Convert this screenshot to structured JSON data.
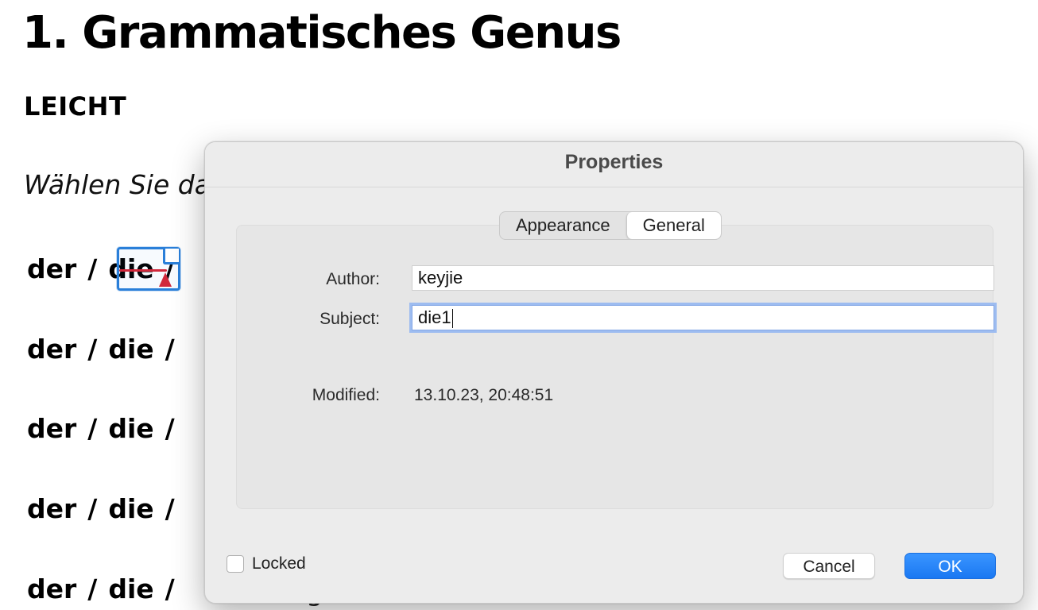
{
  "document": {
    "title": "1. Grammatisches Genus",
    "level": "LEICHT",
    "instruction": "Wählen Sie da",
    "rows": [
      {
        "a": "der",
        "sep1": "/",
        "b": "die",
        "sep2": "/"
      },
      {
        "a": "der",
        "sep1": "/",
        "b": "die",
        "sep2": "/"
      },
      {
        "a": "der",
        "sep1": "/",
        "b": "die",
        "sep2": "/"
      },
      {
        "a": "der",
        "sep1": "/",
        "b": "die",
        "sep2": "/"
      },
      {
        "a": "der",
        "sep1": "/",
        "b": "die",
        "sep2": "/"
      }
    ],
    "trailing_glyph": "g",
    "annotation_color": "#2a7fd9",
    "strike_color": "#d1283b"
  },
  "dialog": {
    "title": "Properties",
    "tabs": [
      {
        "label": "Appearance",
        "selected": false
      },
      {
        "label": "General",
        "selected": true
      }
    ],
    "fields": {
      "author_label": "Author:",
      "author_value": "keyjie",
      "subject_label": "Subject:",
      "subject_value": "die1",
      "modified_label": "Modified:",
      "modified_value": "13.10.23, 20:48:51"
    },
    "locked_label": "Locked",
    "locked_checked": false,
    "cancel_label": "Cancel",
    "ok_label": "OK",
    "accent_color": "#1a78f2"
  }
}
